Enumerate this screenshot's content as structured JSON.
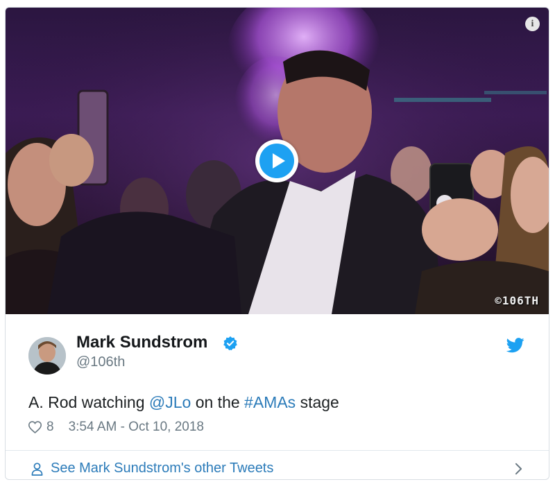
{
  "media": {
    "info_glyph": "i",
    "watermark": "©106TH",
    "play_icon": "play-icon"
  },
  "tweet": {
    "author_name": "Mark Sundstrom",
    "handle": "@106th",
    "text_before": "A. Rod watching ",
    "mention": "@JLo",
    "text_middle": " on the ",
    "hashtag": "#AMAs",
    "text_after": " stage",
    "like_count": "8",
    "timestamp": "3:54 AM - Oct 10, 2018",
    "footer_link": "See Mark Sundstrom's other Tweets"
  },
  "colors": {
    "link": "#2b7bb9",
    "twitter_blue": "#1da1f2",
    "muted": "#697882"
  }
}
